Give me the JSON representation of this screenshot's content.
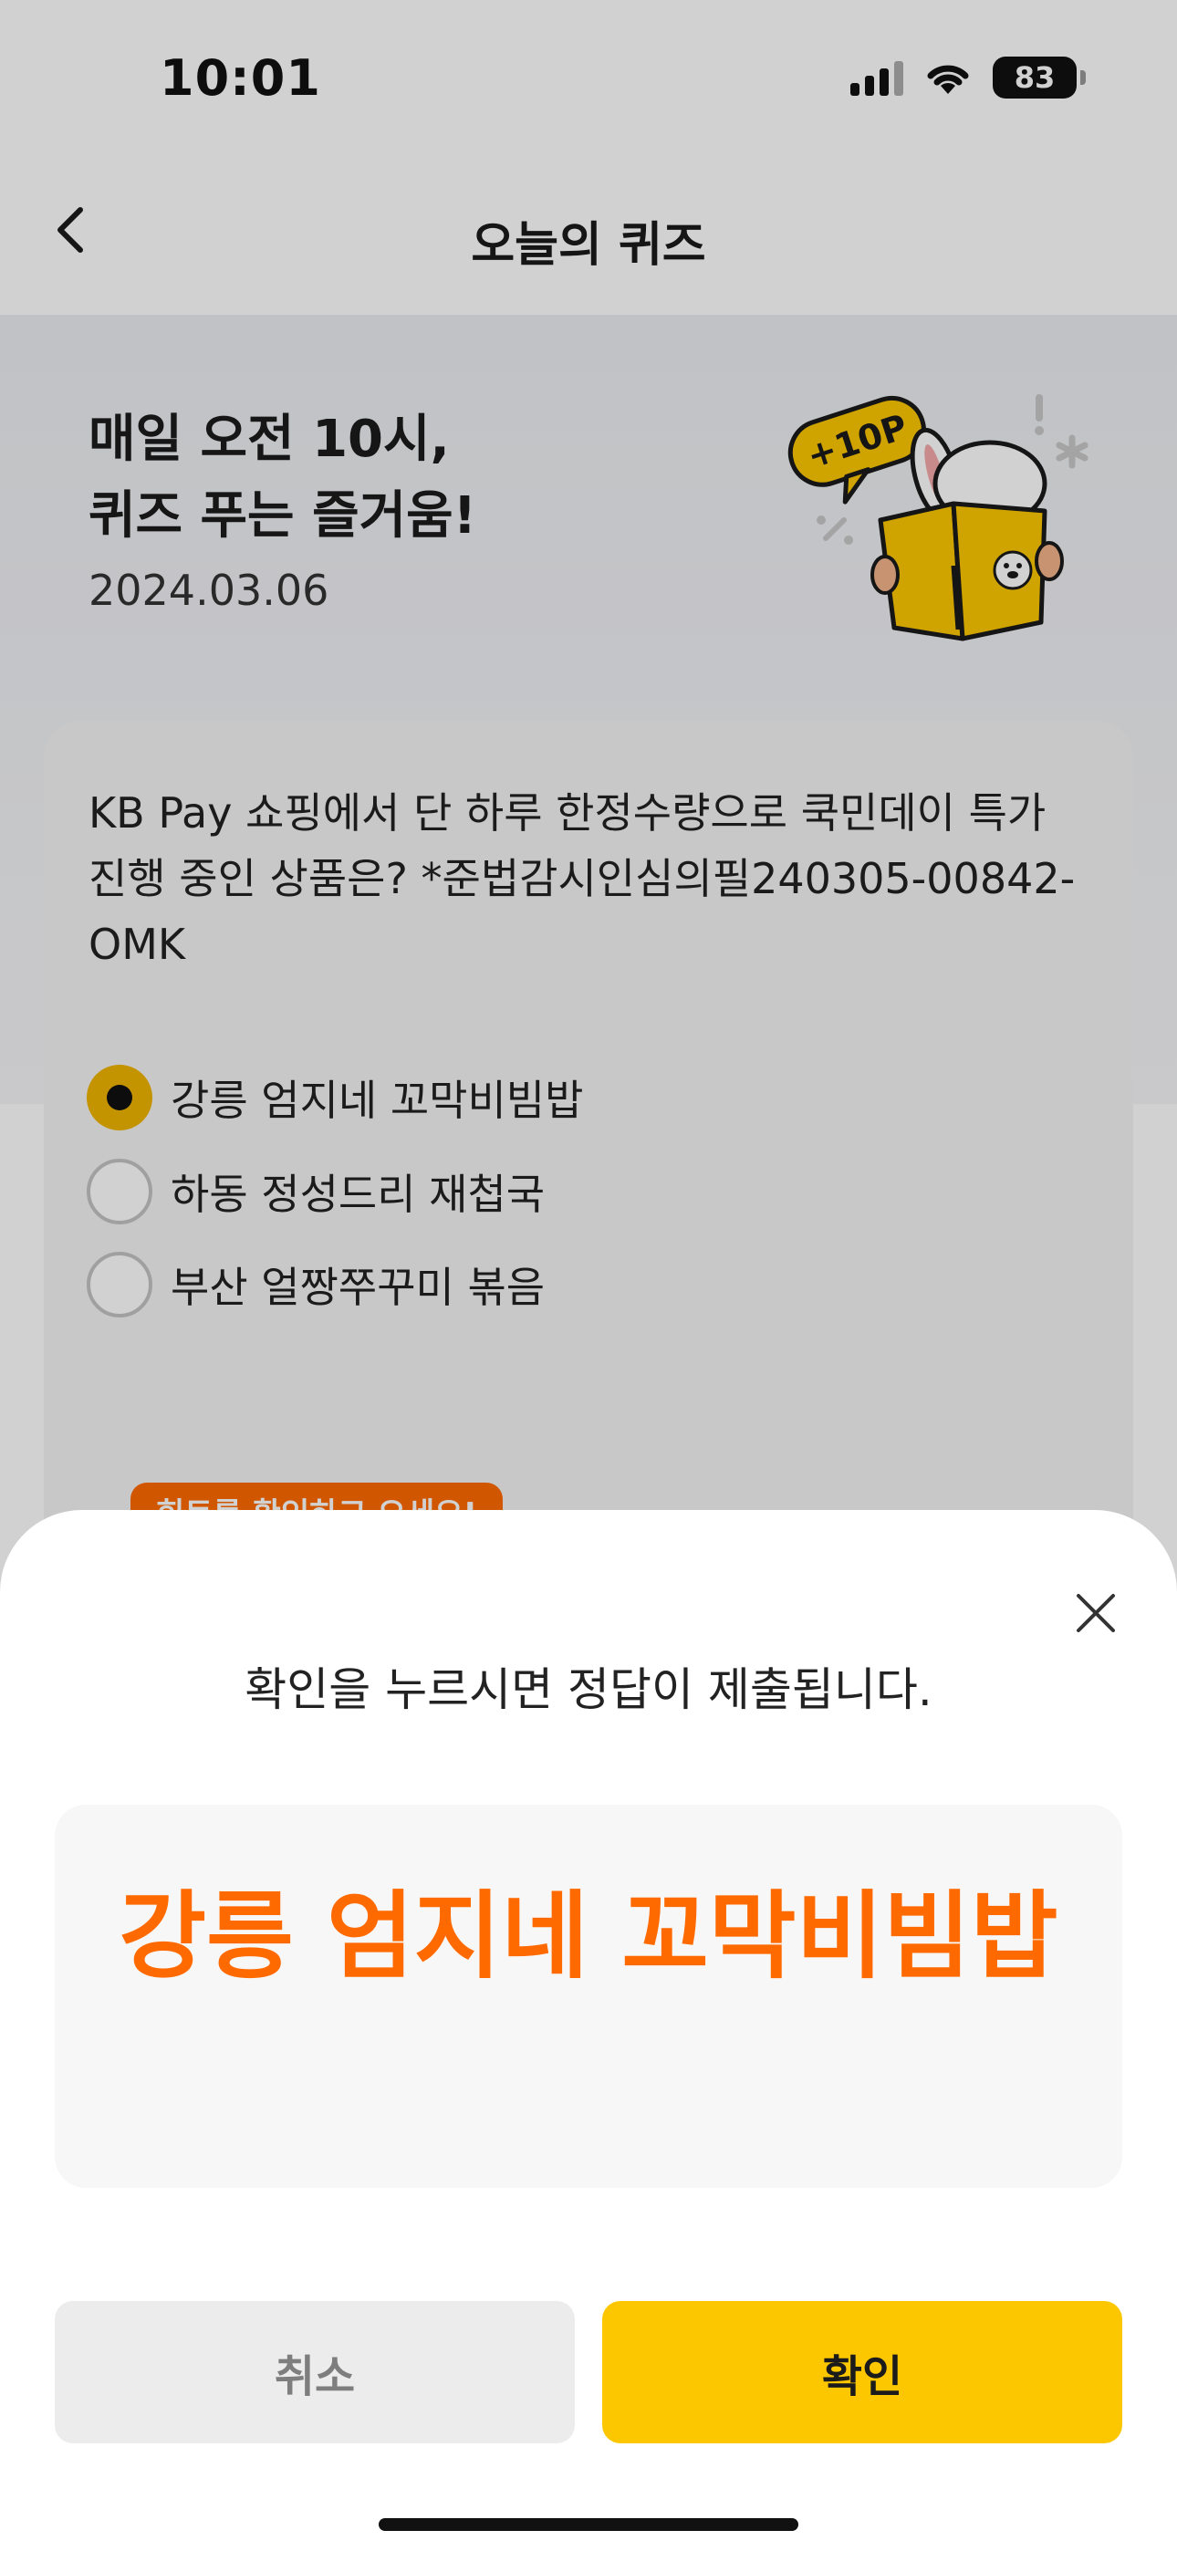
{
  "status_bar": {
    "time": "10:01",
    "battery": "83"
  },
  "nav": {
    "title": "오늘의 퀴즈"
  },
  "hero": {
    "line1": "매일 오전 10시,",
    "line2": "퀴즈 푸는 즐거움!",
    "date": "2024.03.06",
    "badge": "+10P"
  },
  "quiz": {
    "question": "KB Pay 쇼핑에서 단 하루 한정수량으로 쿡민데이 특가 진행 중인 상품은? *준법감시인심의필240305-00842-OMK",
    "options": [
      {
        "label": "강릉 엄지네 꼬막비빔밥",
        "selected": true
      },
      {
        "label": "하동 정성드리 재첩국",
        "selected": false
      },
      {
        "label": "부산 얼짱쭈꾸미 볶음",
        "selected": false
      }
    ],
    "hint_tag": "힌트를 확인하고 오세요!"
  },
  "sheet": {
    "notice": "확인을 누르시면 정답이 제출됩니다.",
    "answer": "강릉 엄지네 꼬막비빔밥",
    "cancel_label": "취소",
    "confirm_label": "확인"
  },
  "colors": {
    "accent_orange": "#ff6a00",
    "accent_yellow": "#fdc700"
  }
}
